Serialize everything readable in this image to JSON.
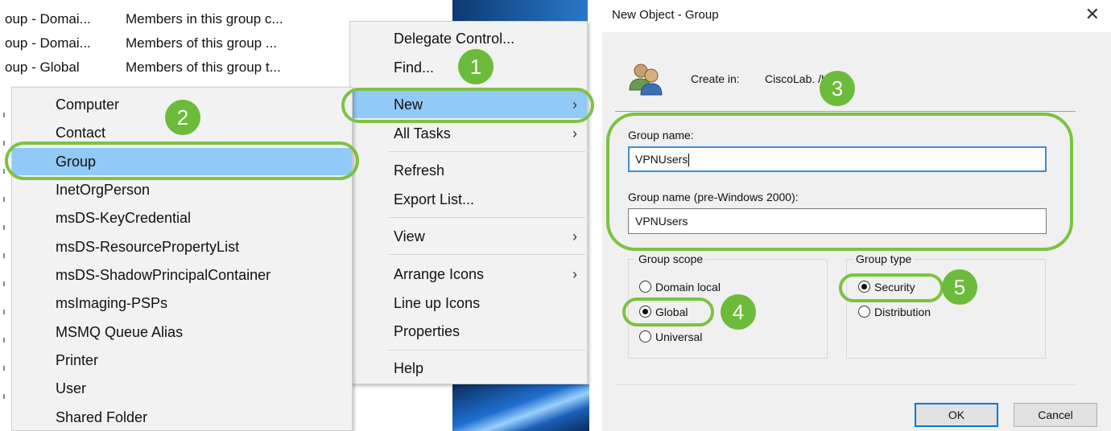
{
  "background_list": {
    "rows": [
      {
        "name": "oup - Domai...",
        "description": "Members in this group c..."
      },
      {
        "name": "oup - Domai...",
        "description": "Members of this group ..."
      },
      {
        "name": "oup - Global",
        "description": "Members of this group t..."
      }
    ]
  },
  "context_menu": {
    "items": [
      {
        "label": "Delegate Control..."
      },
      {
        "label": "Find..."
      },
      {
        "label": "New",
        "arrow": "›"
      },
      {
        "label": "All Tasks",
        "arrow": "›"
      },
      {
        "label": "Refresh"
      },
      {
        "label": "Export List..."
      },
      {
        "label": "View",
        "arrow": "›"
      },
      {
        "label": "Arrange Icons",
        "arrow": "›"
      },
      {
        "label": "Line up Icons"
      },
      {
        "label": "Properties"
      },
      {
        "label": "Help"
      }
    ],
    "highlighted": "New"
  },
  "new_submenu": {
    "items": [
      {
        "label": "Computer"
      },
      {
        "label": "Contact"
      },
      {
        "label": "Group"
      },
      {
        "label": "InetOrgPerson"
      },
      {
        "label": "msDS-KeyCredential"
      },
      {
        "label": "msDS-ResourcePropertyList"
      },
      {
        "label": "msDS-ShadowPrincipalContainer"
      },
      {
        "label": "msImaging-PSPs"
      },
      {
        "label": "MSMQ Queue Alias"
      },
      {
        "label": "Printer"
      },
      {
        "label": "User"
      },
      {
        "label": "Shared Folder"
      }
    ],
    "highlighted": "Group"
  },
  "dialog": {
    "title": "New Object - Group",
    "close_glyph": "✕",
    "create_in_label": "Create in:",
    "create_in_value": "CiscoLab.     /Users",
    "group_name_label": "Group name:",
    "group_name_value": "VPNUsers",
    "pre2000_label": "Group name (pre-Windows 2000):",
    "pre2000_value": "VPNUsers",
    "scope": {
      "legend": "Group scope",
      "options": [
        "Domain local",
        "Global",
        "Universal"
      ],
      "selected": "Global"
    },
    "type": {
      "legend": "Group type",
      "options": [
        "Security",
        "Distribution"
      ],
      "selected": "Security"
    },
    "ok_label": "OK",
    "cancel_label": "Cancel"
  },
  "annotations": {
    "steps": [
      "1",
      "2",
      "3",
      "4",
      "5"
    ],
    "color": "#6dbb3a"
  },
  "colors": {
    "menu_highlight": "#91c9f7",
    "focus_border": "#3c8cd8",
    "default_button_border": "#0078d7"
  }
}
